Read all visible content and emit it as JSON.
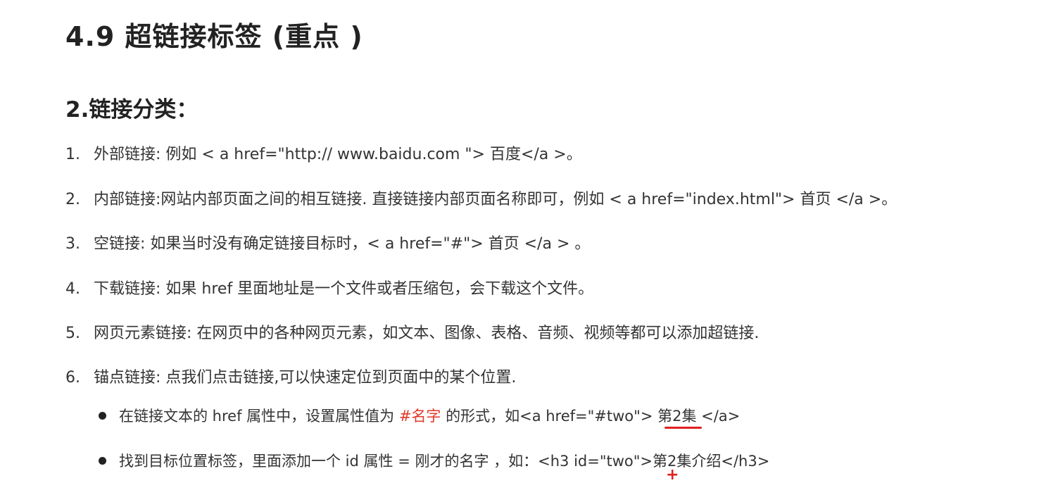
{
  "heading": "4.9 超链接标签 (重点 )",
  "section_title": "2.链接分类：",
  "items": [
    {
      "num": "1.",
      "text": "外部链接: 例如 < a href=\"http:// www.baidu.com \"> 百度</a >。"
    },
    {
      "num": "2.",
      "text": "内部链接:网站内部页面之间的相互链接. 直接链接内部页面名称即可，例如 < a href=\"index.html\"> 首页 </a >。"
    },
    {
      "num": "3.",
      "text": "空链接: 如果当时没有确定链接目标时，< a href=\"#\"> 首页 </a > 。"
    },
    {
      "num": "4.",
      "text": "下载链接: 如果 href 里面地址是一个文件或者压缩包，会下载这个文件。"
    },
    {
      "num": "5.",
      "text": "网页元素链接: 在网页中的各种网页元素，如文本、图像、表格、音频、视频等都可以添加超链接."
    },
    {
      "num": "6.",
      "text": "锚点链接:  点我们点击链接,可以快速定位到页面中的某个位置."
    }
  ],
  "bullets": [
    {
      "before": "在链接文本的 href 属性中，设置属性值为 ",
      "highlight": "#名字",
      "after": " 的形式，如<a href=\"#two\"> 第2集 </a>"
    },
    {
      "text": "找到目标位置标签，里面添加一个 id 属性 = 刚才的名字 ，如：<h3 id=\"two\">第2集介绍</h3>"
    }
  ],
  "annotation_plus": "+",
  "colors": {
    "highlight": "#e03a2a",
    "annotation": "#e02020"
  }
}
